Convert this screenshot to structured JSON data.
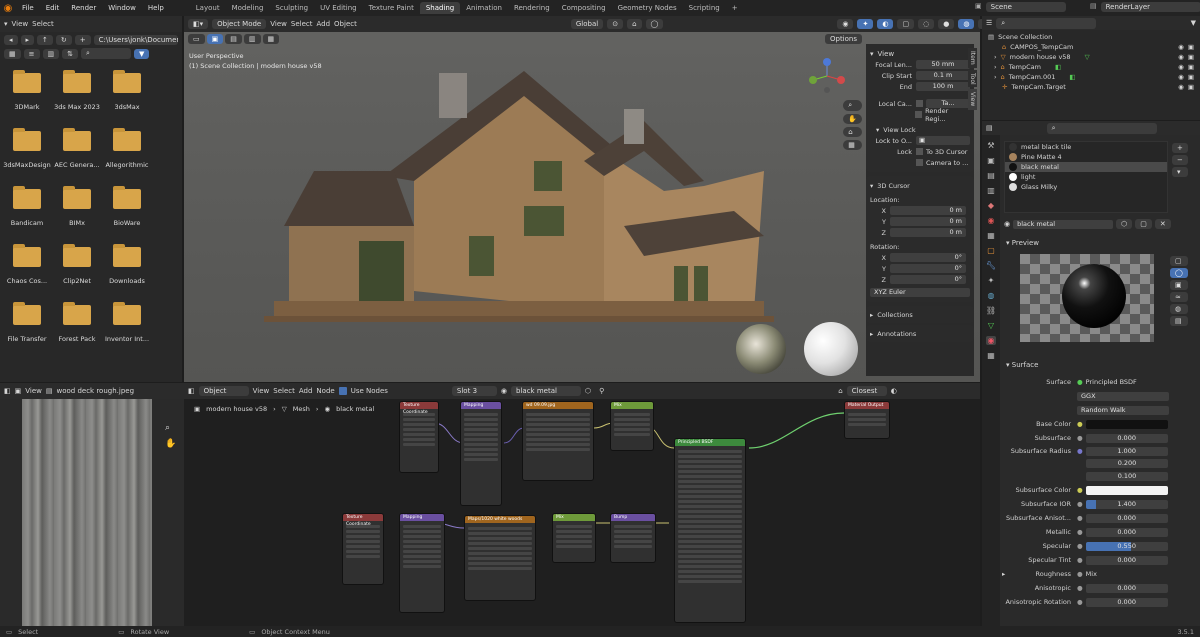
{
  "topbar": {
    "menu": [
      "File",
      "Edit",
      "Render",
      "Window",
      "Help"
    ],
    "tabs": [
      "Layout",
      "Modeling",
      "Sculpting",
      "UV Editing",
      "Texture Paint",
      "Shading",
      "Animation",
      "Rendering",
      "Compositing",
      "Geometry Nodes",
      "Scripting"
    ],
    "active_tab": "Shading",
    "scene": "Scene",
    "view_layer": "RenderLayer"
  },
  "filebrowser": {
    "header": {
      "view": "View",
      "select": "Select"
    },
    "path": "C:\\Users\\jonk\\Documents\\",
    "folders": [
      "3DMark",
      "3ds Max 2023",
      "3dsMax",
      "3dsMaxDesign",
      "AEC Genera...",
      "Allegorithmic",
      "Bandicam",
      "BIMx",
      "BioWare",
      "Chaos Cos...",
      "Clip2Net",
      "Downloads",
      "File Transfer",
      "Forest Pack",
      "Inventor Int..."
    ]
  },
  "viewport": {
    "mode": "Object Mode",
    "menu": [
      "View",
      "Select",
      "Add",
      "Object"
    ],
    "transform": "Global",
    "options": "Options",
    "overlay_line1": "User Perspective",
    "overlay_line2": "(1) Scene Collection | modern house v58"
  },
  "npanel": {
    "view_title": "View",
    "focal_label": "Focal Len...",
    "focal_value": "50 mm",
    "clip_start_label": "Clip Start",
    "clip_start_value": "0.1 m",
    "end_label": "End",
    "end_value": "100 m",
    "local_camera_label": "Local Ca...",
    "local_camera_value": "Ta...",
    "render_region": "Render Regi...",
    "view_lock_title": "View Lock",
    "lock_to_label": "Lock to O...",
    "lock_label": "Lock",
    "to_3d_cursor": "To 3D Cursor",
    "camera_to": "Camera to ...",
    "cursor_title": "3D Cursor",
    "location_label": "Location:",
    "rotation_label": "Rotation:",
    "loc": [
      {
        "axis": "X",
        "value": "0 m"
      },
      {
        "axis": "Y",
        "value": "0 m"
      },
      {
        "axis": "Z",
        "value": "0 m"
      }
    ],
    "rot": [
      {
        "axis": "X",
        "value": "0°"
      },
      {
        "axis": "Y",
        "value": "0°"
      },
      {
        "axis": "Z",
        "value": "0°"
      }
    ],
    "rotation_mode": "XYZ Euler",
    "collections": "Collections",
    "annotations": "Annotations",
    "side_tabs": [
      "Item",
      "Tool",
      "View"
    ]
  },
  "image_editor": {
    "view": "View",
    "image_name": "wood deck rough.jpeg"
  },
  "node_editor": {
    "object": "Object",
    "menu": [
      "View",
      "Select",
      "Add",
      "Node"
    ],
    "use_nodes": "Use Nodes",
    "slot": "Slot 3",
    "material": "black metal",
    "closest": "Closest",
    "breadcrumb": [
      "modern house v58",
      "Mesh",
      "black metal"
    ],
    "nodes": [
      {
        "title": "Texture Coordinate",
        "color": "#8b3a3a"
      },
      {
        "title": "Mapping",
        "color": "#6a4fa0"
      },
      {
        "title": "wd 09.09.jpg",
        "color": "#a0651e"
      },
      {
        "title": "Mix",
        "color": "#6e9a3a"
      },
      {
        "title": "Principled BSDF",
        "color": "#3d8a3d"
      },
      {
        "title": "Material Output",
        "color": "#8b3a3a"
      },
      {
        "title": "Texture Coordinate",
        "color": "#8b3a3a"
      },
      {
        "title": "Mapping",
        "color": "#6a4fa0"
      },
      {
        "title": "Maps/1020 white woods",
        "color": "#a0651e"
      },
      {
        "title": "Mix",
        "color": "#6e9a3a"
      },
      {
        "title": "Bump",
        "color": "#6a4fa0"
      }
    ]
  },
  "outliner": {
    "title": "Scene Collection",
    "items": [
      "CAMPOS_TempCam",
      "modern house v58",
      "TempCam",
      "TempCam.001",
      "TempCam.Target"
    ]
  },
  "properties": {
    "materials": [
      "metal black tile",
      "Pine Matte 4",
      "black metal",
      "light",
      "Glass Milky"
    ],
    "selected_material": "black metal",
    "material_field": "black metal",
    "preview": "Preview",
    "surface_section": "Surface",
    "surface_label": "Surface",
    "surface_value": "Principled BSDF",
    "distribution": "GGX",
    "subsurface_method": "Random Walk",
    "props": [
      {
        "label": "Base Color",
        "value": "",
        "kind": "color-dark"
      },
      {
        "label": "Subsurface",
        "value": "0.000",
        "kind": "num"
      },
      {
        "label": "Subsurface Radius",
        "value": "1.000",
        "kind": "num"
      },
      {
        "label": "",
        "value": "0.200",
        "kind": "num"
      },
      {
        "label": "",
        "value": "0.100",
        "kind": "num"
      },
      {
        "label": "Subsurface Color",
        "value": "",
        "kind": "color-white"
      },
      {
        "label": "Subsurface IOR",
        "value": "1.400",
        "kind": "num"
      },
      {
        "label": "Subsurface Anisot...",
        "value": "0.000",
        "kind": "num"
      },
      {
        "label": "Metallic",
        "value": "0.000",
        "kind": "num"
      },
      {
        "label": "Specular",
        "value": "0.550",
        "kind": "bar"
      },
      {
        "label": "Specular Tint",
        "value": "0.000",
        "kind": "num"
      },
      {
        "label": "Roughness",
        "value": "Mix",
        "kind": "link"
      },
      {
        "label": "Anisotropic",
        "value": "0.000",
        "kind": "num"
      },
      {
        "label": "Anisotropic Rotation",
        "value": "0.000",
        "kind": "num"
      }
    ]
  },
  "statusbar": {
    "select": "Select",
    "rotate": "Rotate View",
    "context": "Object Context Menu",
    "version": "3.5.1"
  },
  "colors": {
    "accent": "#4772b3",
    "folder": "#d8a54a",
    "viewport_bg": "#5a5a58"
  }
}
